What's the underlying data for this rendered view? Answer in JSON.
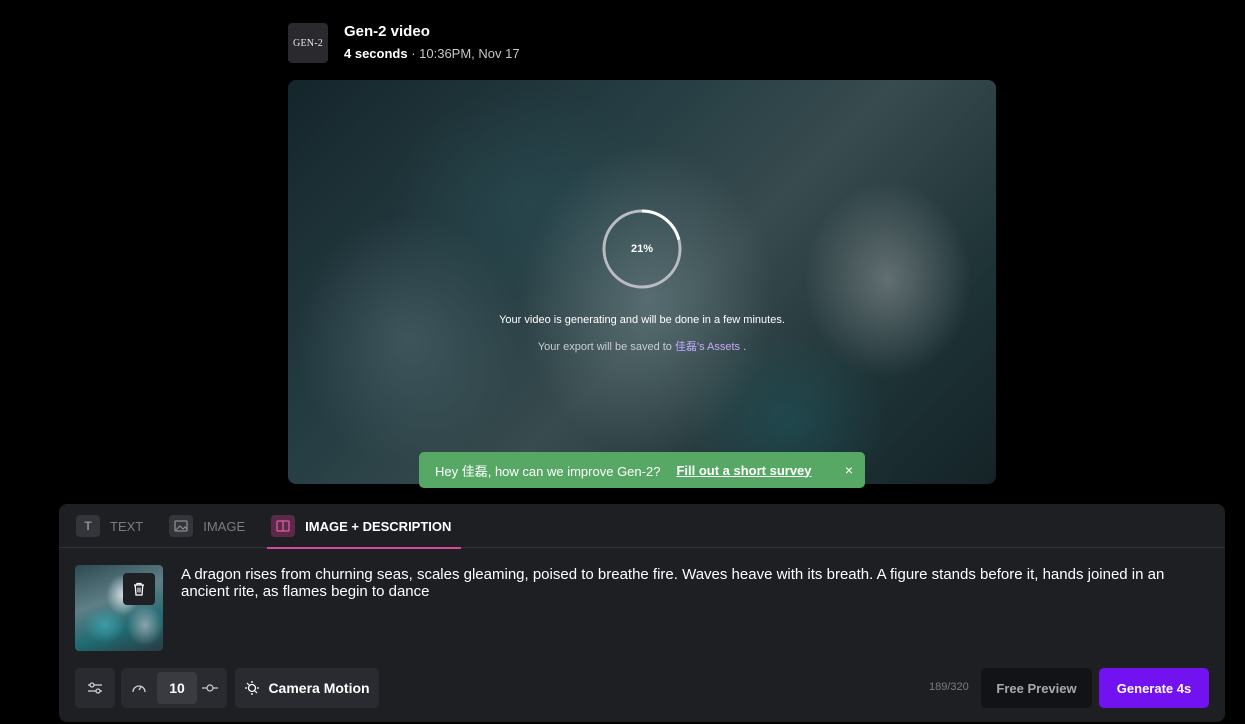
{
  "header": {
    "logo_text": "GEN-2",
    "title": "Gen-2 video",
    "duration": "4 seconds",
    "timestamp": " · 10:36PM, Nov 17"
  },
  "preview": {
    "progress_percent": 21,
    "progress_label": "21%",
    "generating_message": "Your video is generating and will be done in a few minutes.",
    "export_prefix": "Your export will be saved to ",
    "export_link": "佳磊's Assets",
    "export_suffix": " ."
  },
  "toast": {
    "question": "Hey 佳磊, how can we improve Gen-2?",
    "link": "Fill out a short survey",
    "close": "×",
    "color": "#57a865"
  },
  "tabs": [
    {
      "label": "TEXT",
      "icon": "text-icon",
      "active": false
    },
    {
      "label": "IMAGE",
      "icon": "image-icon",
      "active": false
    },
    {
      "label": "IMAGE + DESCRIPTION",
      "icon": "image-description-icon",
      "active": true
    }
  ],
  "prompt": {
    "text": "A dragon rises from churning seas, scales gleaming, poised to breathe fire. Waves heave with its breath. A figure stands before it, hands joined in an ancient rite, as flames begin to dance"
  },
  "controls": {
    "motion_value": "10",
    "camera_motion_label": "Camera Motion",
    "char_count": "189/320",
    "free_preview_label": "Free Preview",
    "generate_label": "Generate 4s",
    "accent": "#7212f0"
  }
}
